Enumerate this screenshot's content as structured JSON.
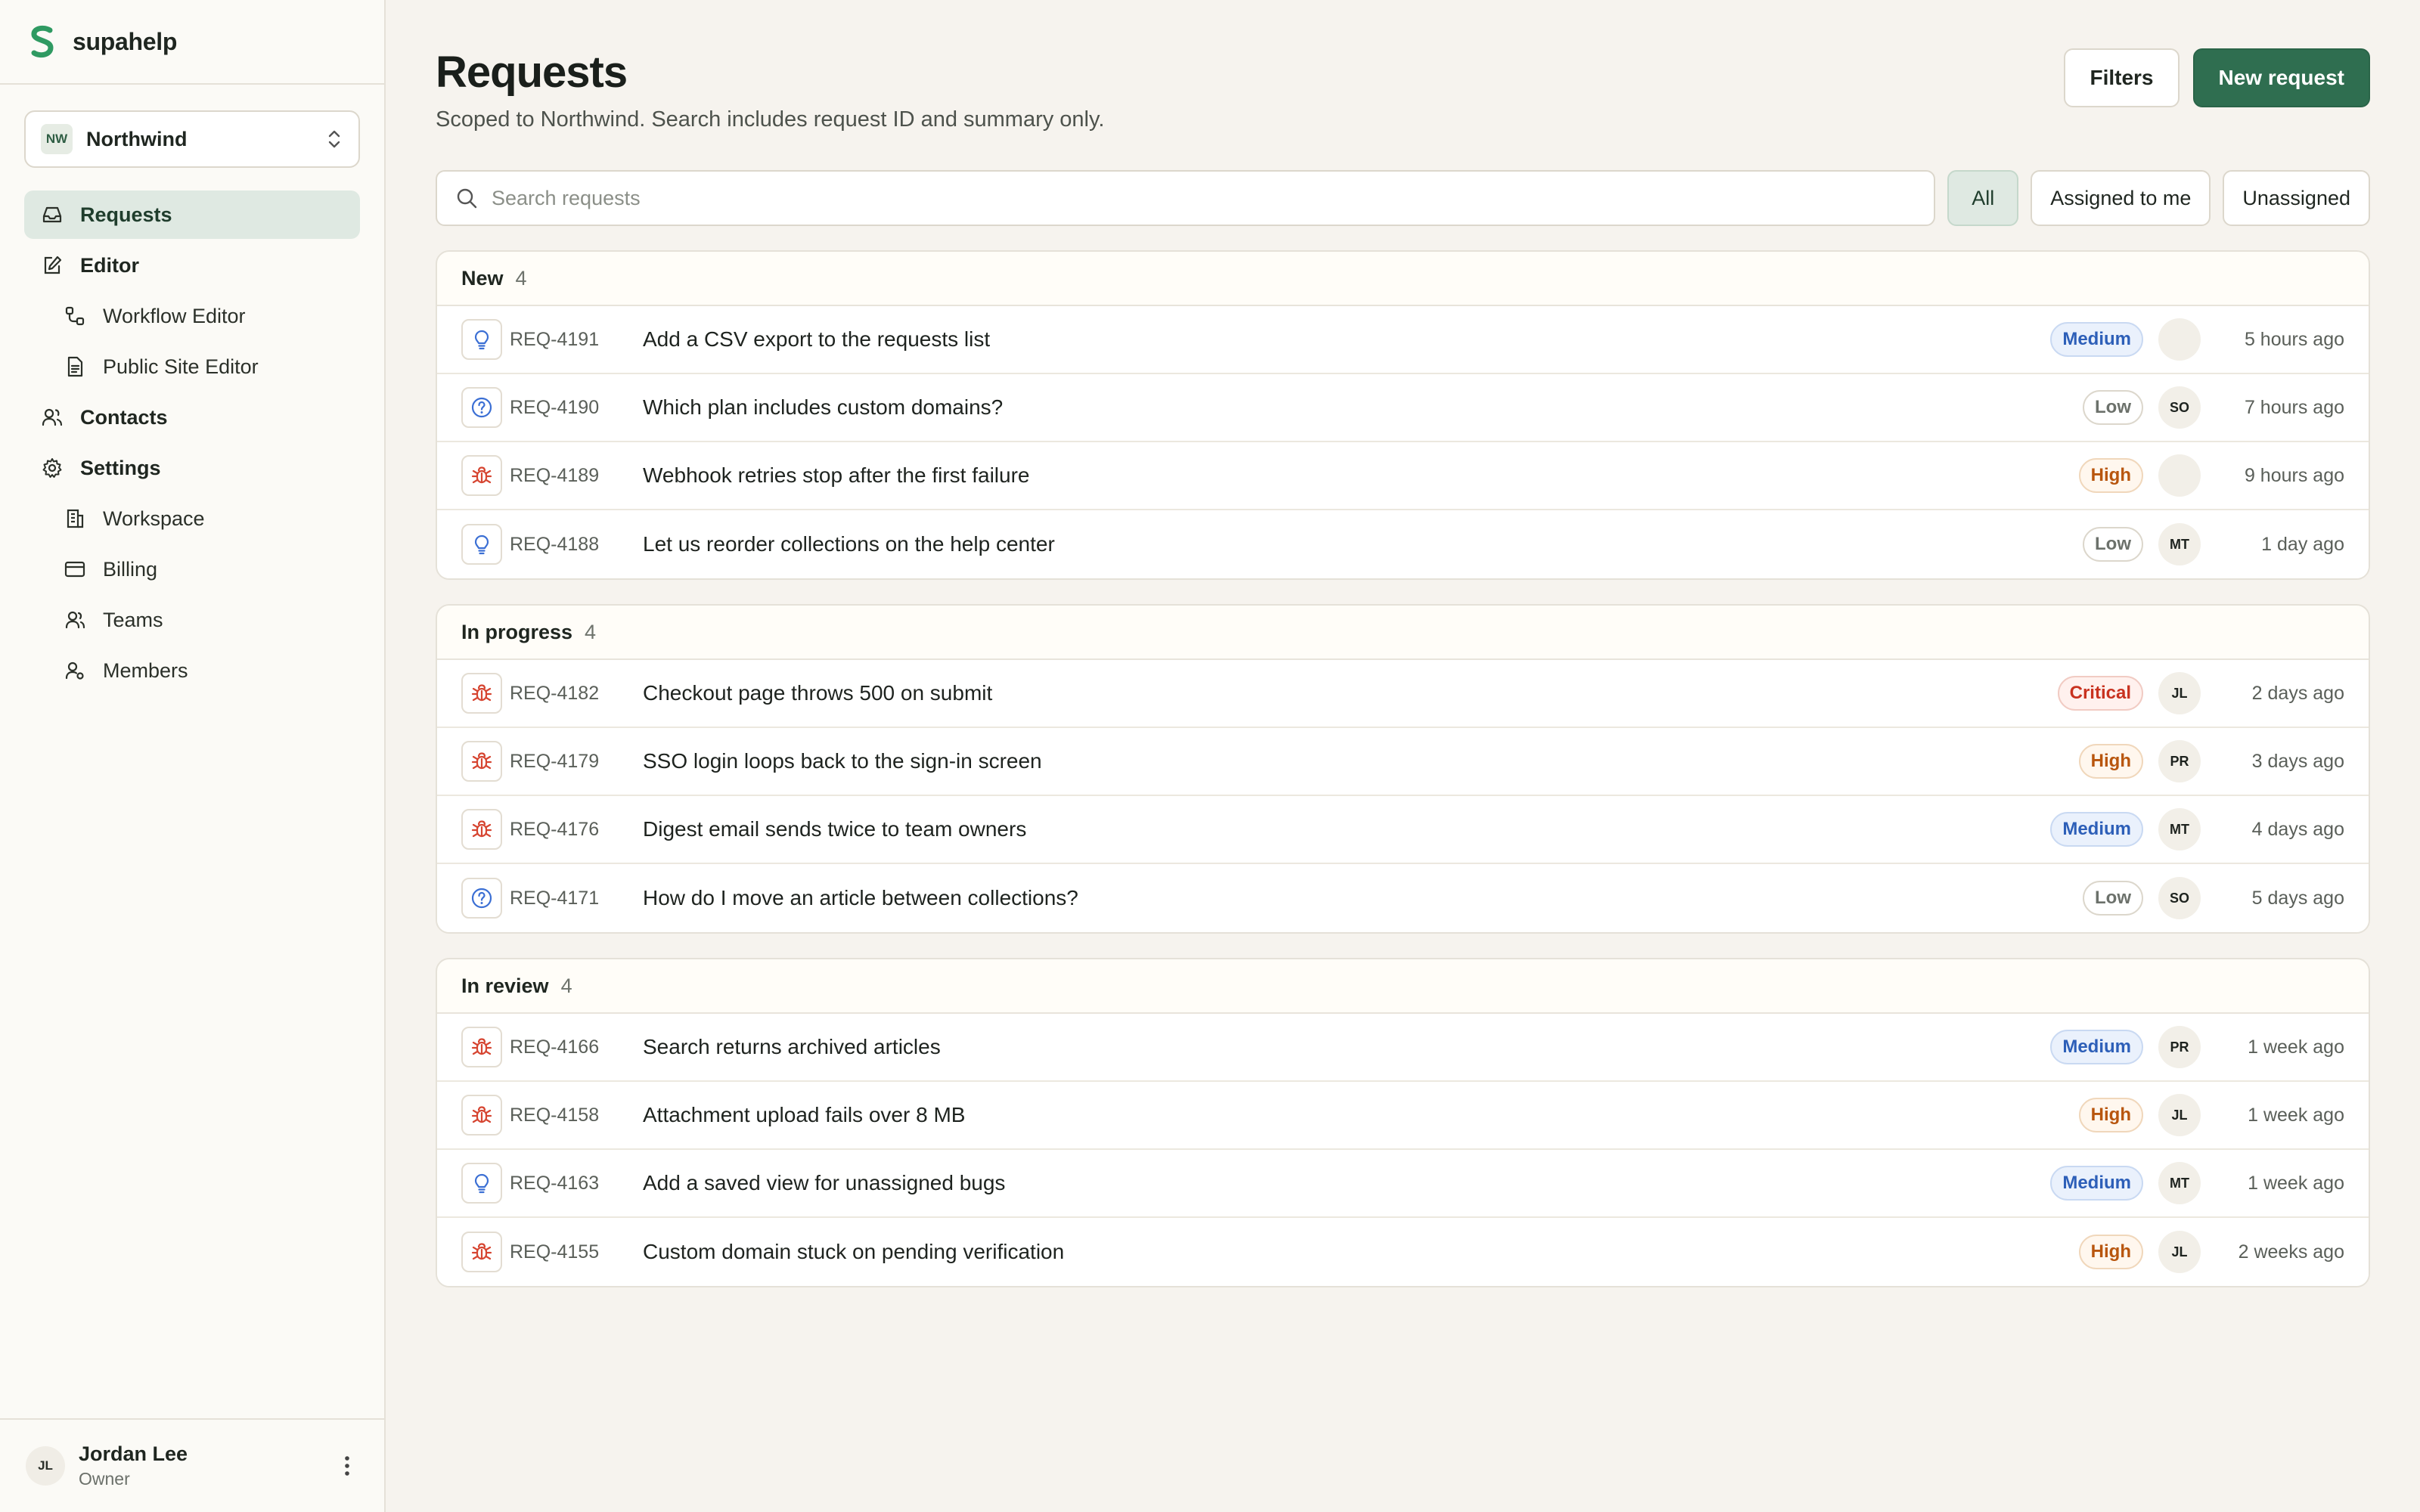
{
  "brand": {
    "name": "supahelp"
  },
  "workspace": {
    "initials": "NW",
    "name": "Northwind"
  },
  "sidebar": {
    "items": [
      {
        "label": "Requests",
        "icon": "inbox-icon",
        "sub": false,
        "active": true
      },
      {
        "label": "Editor",
        "icon": "pencil-square-icon",
        "sub": false,
        "active": false
      },
      {
        "label": "Workflow Editor",
        "icon": "workflow-icon",
        "sub": true,
        "active": false
      },
      {
        "label": "Public Site Editor",
        "icon": "file-text-icon",
        "sub": true,
        "active": false
      },
      {
        "label": "Contacts",
        "icon": "users-icon",
        "sub": false,
        "active": false
      },
      {
        "label": "Settings",
        "icon": "gear-icon",
        "sub": false,
        "active": false
      },
      {
        "label": "Workspace",
        "icon": "building-icon",
        "sub": true,
        "active": false
      },
      {
        "label": "Billing",
        "icon": "credit-card-icon",
        "sub": true,
        "active": false
      },
      {
        "label": "Teams",
        "icon": "team-icon",
        "sub": true,
        "active": false
      },
      {
        "label": "Members",
        "icon": "user-gear-icon",
        "sub": true,
        "active": false
      }
    ]
  },
  "user": {
    "initials": "JL",
    "name": "Jordan Lee",
    "role": "Owner"
  },
  "header": {
    "title": "Requests",
    "subtitle": "Scoped to Northwind. Search includes request ID and summary only.",
    "filters_label": "Filters",
    "new_label": "New request"
  },
  "search": {
    "placeholder": "Search requests",
    "value": ""
  },
  "chips": [
    {
      "label": "All",
      "active": true
    },
    {
      "label": "Assigned to me",
      "active": false
    },
    {
      "label": "Unassigned",
      "active": false
    }
  ],
  "colors": {
    "accent": "#2f6e50",
    "bug": "#d64531",
    "idea": "#3b6fd4",
    "question": "#3b6fd4"
  },
  "groups": [
    {
      "name": "New",
      "count": "4",
      "rows": [
        {
          "type": "idea",
          "id": "REQ-4191",
          "title": "Add a CSV export to the requests list",
          "priority": "Medium",
          "prio_class": "medium",
          "assignee": "",
          "time": "5 hours ago"
        },
        {
          "type": "question",
          "id": "REQ-4190",
          "title": "Which plan includes custom domains?",
          "priority": "Low",
          "prio_class": "low",
          "assignee": "SO",
          "time": "7 hours ago"
        },
        {
          "type": "bug",
          "id": "REQ-4189",
          "title": "Webhook retries stop after the first failure",
          "priority": "High",
          "prio_class": "high",
          "assignee": "",
          "time": "9 hours ago"
        },
        {
          "type": "idea",
          "id": "REQ-4188",
          "title": "Let us reorder collections on the help center",
          "priority": "Low",
          "prio_class": "low",
          "assignee": "MT",
          "time": "1 day ago"
        }
      ]
    },
    {
      "name": "In progress",
      "count": "4",
      "rows": [
        {
          "type": "bug",
          "id": "REQ-4182",
          "title": "Checkout page throws 500 on submit",
          "priority": "Critical",
          "prio_class": "critical",
          "assignee": "JL",
          "time": "2 days ago"
        },
        {
          "type": "bug",
          "id": "REQ-4179",
          "title": "SSO login loops back to the sign-in screen",
          "priority": "High",
          "prio_class": "high",
          "assignee": "PR",
          "time": "3 days ago"
        },
        {
          "type": "bug",
          "id": "REQ-4176",
          "title": "Digest email sends twice to team owners",
          "priority": "Medium",
          "prio_class": "medium",
          "assignee": "MT",
          "time": "4 days ago"
        },
        {
          "type": "question",
          "id": "REQ-4171",
          "title": "How do I move an article between collections?",
          "priority": "Low",
          "prio_class": "low",
          "assignee": "SO",
          "time": "5 days ago"
        }
      ]
    },
    {
      "name": "In review",
      "count": "4",
      "rows": [
        {
          "type": "bug",
          "id": "REQ-4166",
          "title": "Search returns archived articles",
          "priority": "Medium",
          "prio_class": "medium",
          "assignee": "PR",
          "time": "1 week ago"
        },
        {
          "type": "bug",
          "id": "REQ-4158",
          "title": "Attachment upload fails over 8 MB",
          "priority": "High",
          "prio_class": "high",
          "assignee": "JL",
          "time": "1 week ago"
        },
        {
          "type": "idea",
          "id": "REQ-4163",
          "title": "Add a saved view for unassigned bugs",
          "priority": "Medium",
          "prio_class": "medium",
          "assignee": "MT",
          "time": "1 week ago"
        },
        {
          "type": "bug",
          "id": "REQ-4155",
          "title": "Custom domain stuck on pending verification",
          "priority": "High",
          "prio_class": "high",
          "assignee": "JL",
          "time": "2 weeks ago"
        }
      ]
    }
  ]
}
